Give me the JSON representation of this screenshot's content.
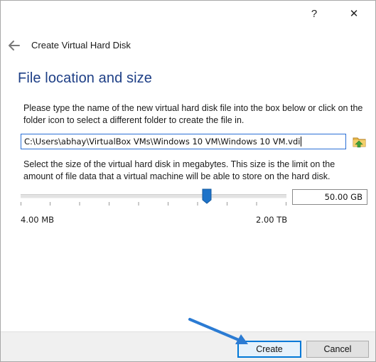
{
  "titlebar": {
    "help_label": "?",
    "close_label": "✕"
  },
  "wizard": {
    "title": "Create Virtual Hard Disk",
    "back_icon": "back-arrow-icon"
  },
  "section": {
    "heading": "File location and size",
    "location_instructions": "Please type the name of the new virtual hard disk file into the box below or click on the folder icon to select a different folder to create the file in.",
    "file_path": "C:\\Users\\abhay\\VirtualBox VMs\\Windows 10 VM\\Windows 10 VM.vdi",
    "folder_icon": "folder-icon",
    "size_instructions": "Select the size of the virtual hard disk in megabytes. This size is the limit on the amount of file data that a virtual machine will be able to store on the hard disk.",
    "size_value": "50.00 GB",
    "slider_position_fraction": 0.7,
    "range_min_label": "4.00 MB",
    "range_max_label": "2.00 TB"
  },
  "buttons": {
    "create_label": "Create",
    "cancel_label": "Cancel"
  },
  "colors": {
    "heading": "#1e3f86",
    "accent": "#0078d7",
    "arrow": "#2b7bd3",
    "slider_thumb": "#1e73c9"
  }
}
